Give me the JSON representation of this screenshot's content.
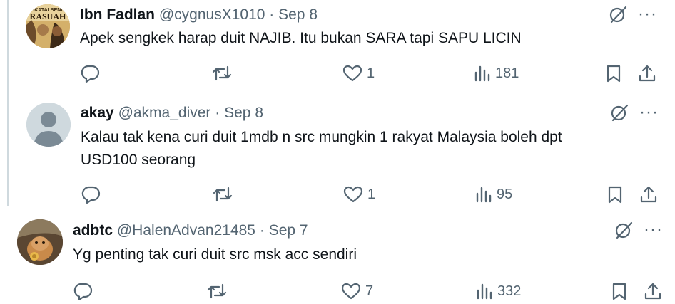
{
  "colors": {
    "text": "#0f1419",
    "secondary": "#536471",
    "background": "#ffffff"
  },
  "icons": {
    "reply": "reply-icon",
    "repost": "repost-icon",
    "like": "heart-icon",
    "views": "views-icon",
    "bookmark": "bookmark-icon",
    "share": "share-icon",
    "grok": "grok-icon",
    "more": "more-icon"
  },
  "tweets": [
    {
      "name": "Ibn Fadlan",
      "handle": "@cygnusX1010",
      "separator": "·",
      "date": "Sep 8",
      "text": "Apek sengkek harap duit NAJIB. Itu bukan SARA tapi SAPU LICIN",
      "likes": "1",
      "views": "181",
      "avatar_text_1": "SKATAI BENU",
      "avatar_text_2": "RASUAH"
    },
    {
      "name": "akay",
      "handle": "@akma_diver",
      "separator": "·",
      "date": "Sep 8",
      "text_line1": "Kalau tak kena curi duit 1mdb n src mungkin 1 rakyat Malaysia boleh dpt",
      "text_line2": "USD100 seorang",
      "likes": "1",
      "views": "95"
    },
    {
      "name": "adbtc",
      "handle": "@HalenAdvan21485",
      "separator": "·",
      "date": "Sep 7",
      "text": "Yg penting tak curi duit src msk acc sendiri",
      "likes": "7",
      "views": "332"
    }
  ],
  "more_label": "···"
}
